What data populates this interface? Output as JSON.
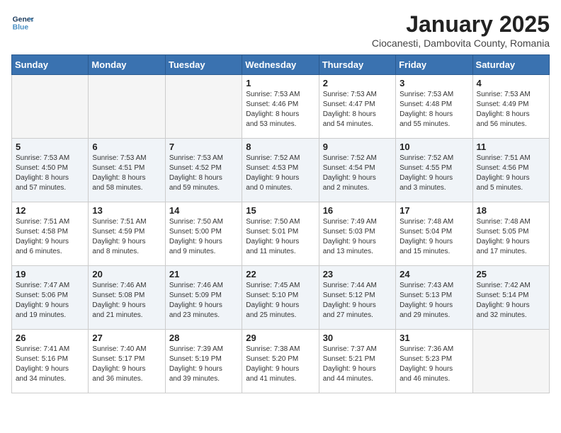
{
  "header": {
    "logo_line1": "General",
    "logo_line2": "Blue",
    "title": "January 2025",
    "subtitle": "Ciocanesti, Dambovita County, Romania"
  },
  "days_of_week": [
    "Sunday",
    "Monday",
    "Tuesday",
    "Wednesday",
    "Thursday",
    "Friday",
    "Saturday"
  ],
  "weeks": [
    [
      {
        "day": "",
        "info": ""
      },
      {
        "day": "",
        "info": ""
      },
      {
        "day": "",
        "info": ""
      },
      {
        "day": "1",
        "info": "Sunrise: 7:53 AM\nSunset: 4:46 PM\nDaylight: 8 hours\nand 53 minutes."
      },
      {
        "day": "2",
        "info": "Sunrise: 7:53 AM\nSunset: 4:47 PM\nDaylight: 8 hours\nand 54 minutes."
      },
      {
        "day": "3",
        "info": "Sunrise: 7:53 AM\nSunset: 4:48 PM\nDaylight: 8 hours\nand 55 minutes."
      },
      {
        "day": "4",
        "info": "Sunrise: 7:53 AM\nSunset: 4:49 PM\nDaylight: 8 hours\nand 56 minutes."
      }
    ],
    [
      {
        "day": "5",
        "info": "Sunrise: 7:53 AM\nSunset: 4:50 PM\nDaylight: 8 hours\nand 57 minutes."
      },
      {
        "day": "6",
        "info": "Sunrise: 7:53 AM\nSunset: 4:51 PM\nDaylight: 8 hours\nand 58 minutes."
      },
      {
        "day": "7",
        "info": "Sunrise: 7:53 AM\nSunset: 4:52 PM\nDaylight: 8 hours\nand 59 minutes."
      },
      {
        "day": "8",
        "info": "Sunrise: 7:52 AM\nSunset: 4:53 PM\nDaylight: 9 hours\nand 0 minutes."
      },
      {
        "day": "9",
        "info": "Sunrise: 7:52 AM\nSunset: 4:54 PM\nDaylight: 9 hours\nand 2 minutes."
      },
      {
        "day": "10",
        "info": "Sunrise: 7:52 AM\nSunset: 4:55 PM\nDaylight: 9 hours\nand 3 minutes."
      },
      {
        "day": "11",
        "info": "Sunrise: 7:51 AM\nSunset: 4:56 PM\nDaylight: 9 hours\nand 5 minutes."
      }
    ],
    [
      {
        "day": "12",
        "info": "Sunrise: 7:51 AM\nSunset: 4:58 PM\nDaylight: 9 hours\nand 6 minutes."
      },
      {
        "day": "13",
        "info": "Sunrise: 7:51 AM\nSunset: 4:59 PM\nDaylight: 9 hours\nand 8 minutes."
      },
      {
        "day": "14",
        "info": "Sunrise: 7:50 AM\nSunset: 5:00 PM\nDaylight: 9 hours\nand 9 minutes."
      },
      {
        "day": "15",
        "info": "Sunrise: 7:50 AM\nSunset: 5:01 PM\nDaylight: 9 hours\nand 11 minutes."
      },
      {
        "day": "16",
        "info": "Sunrise: 7:49 AM\nSunset: 5:03 PM\nDaylight: 9 hours\nand 13 minutes."
      },
      {
        "day": "17",
        "info": "Sunrise: 7:48 AM\nSunset: 5:04 PM\nDaylight: 9 hours\nand 15 minutes."
      },
      {
        "day": "18",
        "info": "Sunrise: 7:48 AM\nSunset: 5:05 PM\nDaylight: 9 hours\nand 17 minutes."
      }
    ],
    [
      {
        "day": "19",
        "info": "Sunrise: 7:47 AM\nSunset: 5:06 PM\nDaylight: 9 hours\nand 19 minutes."
      },
      {
        "day": "20",
        "info": "Sunrise: 7:46 AM\nSunset: 5:08 PM\nDaylight: 9 hours\nand 21 minutes."
      },
      {
        "day": "21",
        "info": "Sunrise: 7:46 AM\nSunset: 5:09 PM\nDaylight: 9 hours\nand 23 minutes."
      },
      {
        "day": "22",
        "info": "Sunrise: 7:45 AM\nSunset: 5:10 PM\nDaylight: 9 hours\nand 25 minutes."
      },
      {
        "day": "23",
        "info": "Sunrise: 7:44 AM\nSunset: 5:12 PM\nDaylight: 9 hours\nand 27 minutes."
      },
      {
        "day": "24",
        "info": "Sunrise: 7:43 AM\nSunset: 5:13 PM\nDaylight: 9 hours\nand 29 minutes."
      },
      {
        "day": "25",
        "info": "Sunrise: 7:42 AM\nSunset: 5:14 PM\nDaylight: 9 hours\nand 32 minutes."
      }
    ],
    [
      {
        "day": "26",
        "info": "Sunrise: 7:41 AM\nSunset: 5:16 PM\nDaylight: 9 hours\nand 34 minutes."
      },
      {
        "day": "27",
        "info": "Sunrise: 7:40 AM\nSunset: 5:17 PM\nDaylight: 9 hours\nand 36 minutes."
      },
      {
        "day": "28",
        "info": "Sunrise: 7:39 AM\nSunset: 5:19 PM\nDaylight: 9 hours\nand 39 minutes."
      },
      {
        "day": "29",
        "info": "Sunrise: 7:38 AM\nSunset: 5:20 PM\nDaylight: 9 hours\nand 41 minutes."
      },
      {
        "day": "30",
        "info": "Sunrise: 7:37 AM\nSunset: 5:21 PM\nDaylight: 9 hours\nand 44 minutes."
      },
      {
        "day": "31",
        "info": "Sunrise: 7:36 AM\nSunset: 5:23 PM\nDaylight: 9 hours\nand 46 minutes."
      },
      {
        "day": "",
        "info": ""
      }
    ]
  ]
}
